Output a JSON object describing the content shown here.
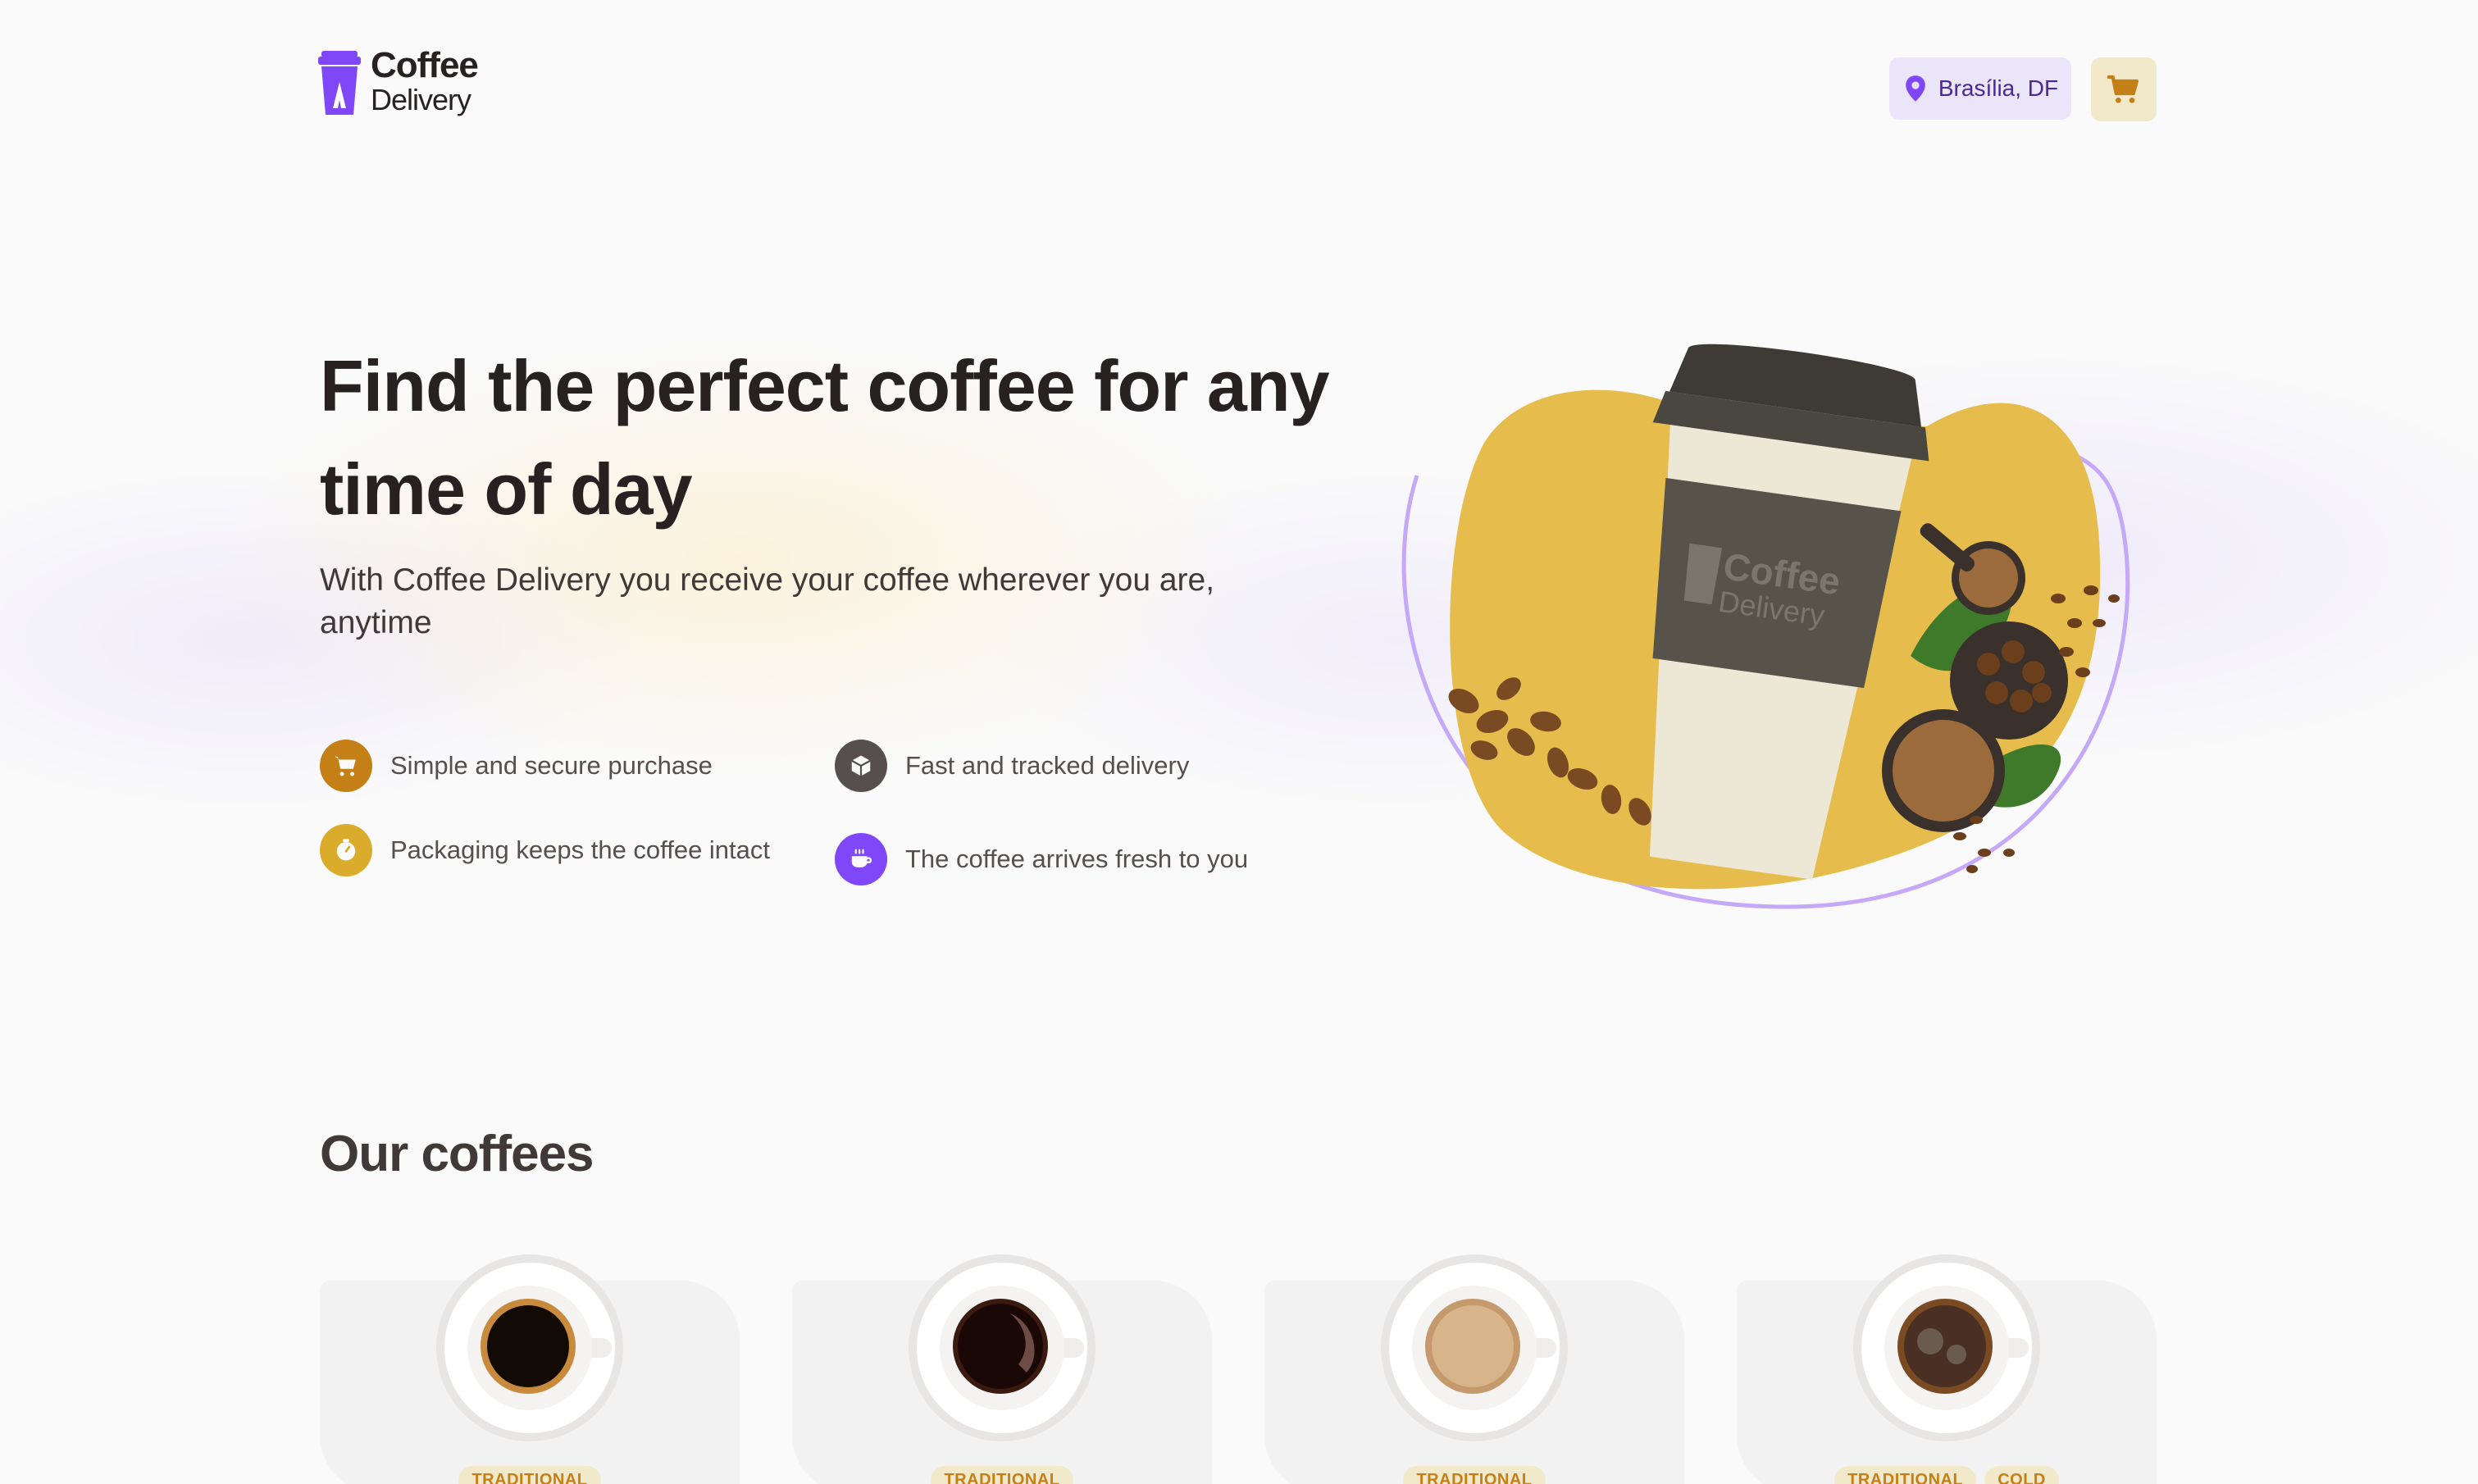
{
  "header": {
    "logo_line1": "Coffee",
    "logo_line2": "Delivery",
    "location": "Brasília, DF",
    "icons": [
      "coffee-cup-logo-icon",
      "map-pin-icon",
      "shopping-cart-icon"
    ]
  },
  "hero": {
    "title": "Find the perfect coffee for any time of day",
    "subtitle": "With Coffee Delivery you receive your coffee wherever you are, anytime",
    "features": [
      {
        "label": "Simple and secure purchase",
        "icon": "shopping-cart-icon",
        "color": "#C47F17"
      },
      {
        "label": "Fast and tracked delivery",
        "icon": "package-icon",
        "color": "#574F4D"
      },
      {
        "label": "Packaging keeps the coffee intact",
        "icon": "timer-icon",
        "color": "#DBAC2C"
      },
      {
        "label": "The coffee arrives fresh to you",
        "icon": "coffee-icon",
        "color": "#8047F8"
      }
    ],
    "image_cup_logo_line1": "Coffee",
    "image_cup_logo_line2": "Delivery"
  },
  "coffees": {
    "title": "Our coffees",
    "items": [
      {
        "tags": [
          "TRADITIONAL"
        ]
      },
      {
        "tags": [
          "TRADITIONAL"
        ]
      },
      {
        "tags": [
          "TRADITIONAL"
        ]
      },
      {
        "tags": [
          "TRADITIONAL",
          "COLD"
        ]
      }
    ]
  },
  "colors": {
    "purple": "#8047F8",
    "purple_dark": "#4B2995",
    "purple_light": "#EBE5F9",
    "yellow": "#DBAC2C",
    "yellow_dark": "#C47F17",
    "yellow_light": "#F1E9C9",
    "background": "#FAFAFA",
    "title": "#272221"
  }
}
